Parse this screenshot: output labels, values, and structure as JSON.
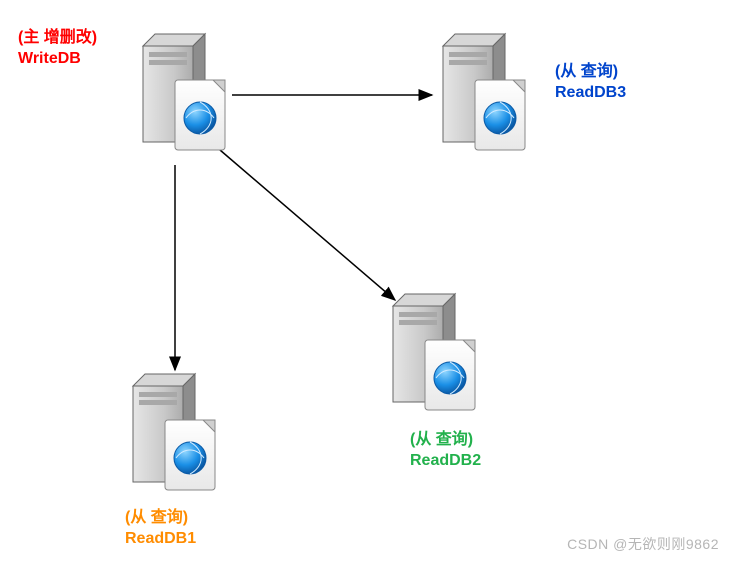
{
  "nodes": {
    "write": {
      "line1": "(主 增删改)",
      "line2": "WriteDB",
      "color": "#ff0000"
    },
    "read1": {
      "line1": "(从 查询)",
      "line2": "ReadDB1",
      "color": "#ff8c00"
    },
    "read2": {
      "line1": "(从 查询)",
      "line2": "ReadDB2",
      "color": "#22b14c"
    },
    "read3": {
      "line1": "(从 查询)",
      "line2": "ReadDB3",
      "color": "#0044cc"
    }
  },
  "watermark": "CSDN @无欲则刚9862",
  "edges": [
    {
      "from": "write",
      "to": "read1"
    },
    {
      "from": "write",
      "to": "read2"
    },
    {
      "from": "write",
      "to": "read3"
    }
  ]
}
